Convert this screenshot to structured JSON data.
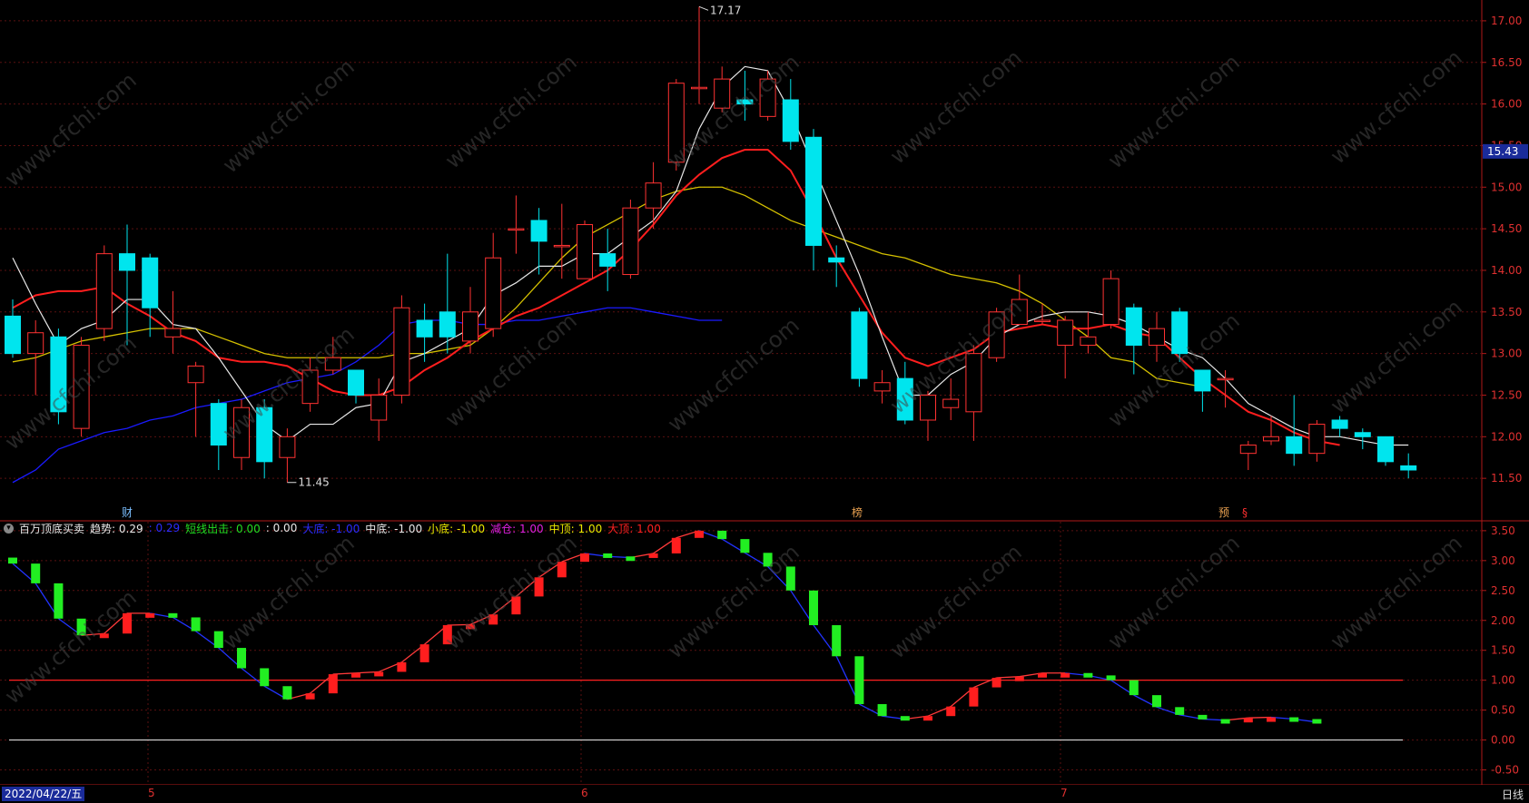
{
  "chart_data": [
    {
      "type": "candlestick",
      "title": "",
      "ylim": [
        11.0,
        17.25
      ],
      "yticks": [
        11.5,
        12.0,
        12.5,
        13.0,
        13.5,
        14.0,
        14.5,
        15.0,
        15.5,
        16.0,
        16.5,
        17.0
      ],
      "current_price": 15.43,
      "annotations": {
        "high": "17.17",
        "low": "11.45"
      },
      "colors": {
        "up": "#ff3232",
        "down": "#00e5ee",
        "ma5": "#e8e8e8",
        "ma10": "#ff1e1e",
        "ma20": "#d4c000",
        "ma60": "#1a1aff"
      },
      "candles": [
        [
          13.45,
          13.0,
          13.65,
          12.95
        ],
        [
          13.0,
          13.25,
          13.4,
          12.5
        ],
        [
          13.2,
          12.3,
          13.3,
          12.15
        ],
        [
          12.1,
          13.1,
          13.2,
          12.0
        ],
        [
          13.3,
          14.2,
          14.3,
          13.15
        ],
        [
          14.2,
          14.0,
          14.55,
          13.1
        ],
        [
          14.15,
          13.55,
          14.2,
          13.2
        ],
        [
          13.2,
          13.3,
          13.75,
          13.0
        ],
        [
          12.65,
          12.85,
          12.9,
          12.0
        ],
        [
          12.4,
          11.9,
          12.45,
          11.6
        ],
        [
          11.75,
          12.35,
          12.45,
          11.6
        ],
        [
          12.35,
          11.7,
          12.45,
          11.5
        ],
        [
          11.75,
          12.0,
          12.1,
          11.45
        ],
        [
          12.4,
          12.8,
          12.95,
          12.3
        ],
        [
          12.8,
          12.95,
          13.2,
          12.75
        ],
        [
          12.8,
          12.5,
          12.8,
          12.4
        ],
        [
          12.2,
          12.5,
          12.7,
          11.95
        ],
        [
          12.5,
          13.55,
          13.7,
          12.4
        ],
        [
          13.4,
          13.2,
          13.6,
          12.9
        ],
        [
          13.5,
          13.2,
          14.2,
          13.0
        ],
        [
          13.15,
          13.5,
          13.8,
          13.0
        ],
        [
          13.3,
          14.15,
          14.45,
          13.2
        ],
        [
          14.5,
          14.5,
          14.9,
          14.2
        ],
        [
          14.6,
          14.35,
          14.75,
          13.95
        ],
        [
          14.3,
          14.3,
          14.8,
          13.9
        ],
        [
          13.9,
          14.55,
          14.6,
          13.9
        ],
        [
          14.2,
          14.05,
          14.5,
          13.75
        ],
        [
          13.95,
          14.75,
          14.85,
          13.9
        ],
        [
          14.75,
          15.05,
          15.3,
          14.5
        ],
        [
          15.3,
          16.25,
          16.3,
          15.2
        ],
        [
          16.2,
          16.2,
          17.17,
          16.0
        ],
        [
          15.95,
          16.3,
          16.45,
          15.9
        ],
        [
          16.05,
          16.0,
          16.4,
          15.8
        ],
        [
          15.85,
          16.3,
          16.4,
          15.8
        ],
        [
          16.05,
          15.55,
          16.3,
          15.45
        ],
        [
          15.6,
          14.3,
          15.7,
          14.0
        ],
        [
          14.15,
          14.1,
          14.3,
          13.8
        ],
        [
          13.5,
          12.7,
          13.55,
          12.6
        ],
        [
          12.55,
          12.65,
          12.8,
          12.4
        ],
        [
          12.7,
          12.2,
          12.9,
          12.15
        ],
        [
          12.2,
          12.5,
          12.55,
          11.95
        ],
        [
          12.35,
          12.45,
          12.7,
          12.2
        ],
        [
          12.3,
          13.0,
          13.1,
          11.95
        ],
        [
          12.95,
          13.5,
          13.55,
          12.9
        ],
        [
          13.35,
          13.65,
          13.95,
          13.35
        ],
        [
          13.4,
          13.4,
          13.6,
          13.35
        ],
        [
          13.1,
          13.4,
          13.45,
          12.7
        ],
        [
          13.1,
          13.2,
          13.5,
          13.0
        ],
        [
          13.35,
          13.9,
          14.0,
          13.3
        ],
        [
          13.55,
          13.1,
          13.6,
          12.75
        ],
        [
          13.1,
          13.3,
          13.5,
          12.9
        ],
        [
          13.5,
          13.0,
          13.55,
          12.9
        ],
        [
          12.8,
          12.55,
          12.8,
          12.3
        ],
        [
          12.7,
          12.7,
          12.8,
          12.35
        ],
        [
          11.8,
          11.9,
          11.95,
          11.6
        ],
        [
          11.95,
          12.0,
          12.25,
          11.9
        ],
        [
          12.0,
          11.8,
          12.5,
          11.65
        ],
        [
          11.8,
          12.15,
          12.2,
          11.7
        ],
        [
          12.2,
          12.1,
          12.25,
          12.0
        ],
        [
          12.05,
          12.0,
          12.1,
          11.85
        ],
        [
          12.0,
          11.7,
          12.0,
          11.65
        ],
        [
          11.65,
          11.6,
          11.8,
          11.5
        ]
      ],
      "ma5": [
        14.15,
        13.6,
        13.1,
        13.3,
        13.4,
        13.65,
        13.65,
        13.35,
        13.3,
        12.95,
        12.55,
        12.15,
        11.95,
        12.15,
        12.15,
        12.35,
        12.4,
        12.9,
        13.0,
        13.15,
        13.3,
        13.7,
        13.85,
        14.05,
        14.05,
        14.2,
        14.2,
        14.4,
        14.6,
        14.95,
        15.7,
        16.2,
        16.45,
        16.4,
        15.9,
        15.25,
        14.6,
        13.95,
        13.2,
        12.5,
        12.5,
        12.75,
        12.9,
        13.2,
        13.35,
        13.45,
        13.5,
        13.5,
        13.45,
        13.35,
        13.2,
        13.05,
        12.95,
        12.7,
        12.4,
        12.25,
        12.1,
        12.0,
        12.0,
        11.95,
        11.9,
        11.9
      ],
      "ma10": [
        13.55,
        13.7,
        13.75,
        13.75,
        13.8,
        13.6,
        13.45,
        13.25,
        13.15,
        12.95,
        12.9,
        12.9,
        12.85,
        12.7,
        12.55,
        12.5,
        12.5,
        12.6,
        12.8,
        12.95,
        13.15,
        13.3,
        13.45,
        13.55,
        13.7,
        13.85,
        14.0,
        14.25,
        14.55,
        14.9,
        15.15,
        15.35,
        15.45,
        15.45,
        15.2,
        14.7,
        14.15,
        13.7,
        13.25,
        12.95,
        12.85,
        12.95,
        13.05,
        13.25,
        13.3,
        13.35,
        13.3,
        13.3,
        13.35,
        13.25,
        13.2,
        12.95,
        12.7,
        12.5,
        12.3,
        12.2,
        12.05,
        11.95,
        11.9
      ],
      "ma20": [
        12.9,
        12.95,
        13.05,
        13.15,
        13.2,
        13.25,
        13.3,
        13.3,
        13.3,
        13.2,
        13.1,
        13.0,
        12.95,
        12.95,
        12.95,
        12.95,
        12.95,
        13.0,
        13.0,
        13.05,
        13.1,
        13.3,
        13.55,
        13.85,
        14.15,
        14.4,
        14.55,
        14.7,
        14.85,
        14.95,
        15.0,
        15.0,
        14.9,
        14.75,
        14.6,
        14.5,
        14.4,
        14.3,
        14.2,
        14.15,
        14.05,
        13.95,
        13.9,
        13.85,
        13.75,
        13.6,
        13.4,
        13.2,
        12.95,
        12.9,
        12.7,
        12.65,
        12.6
      ],
      "ma60": [
        11.45,
        11.6,
        11.85,
        11.95,
        12.05,
        12.1,
        12.2,
        12.25,
        12.35,
        12.4,
        12.45,
        12.55,
        12.65,
        12.7,
        12.75,
        12.9,
        13.1,
        13.35,
        13.4,
        13.4,
        13.35,
        13.35,
        13.4,
        13.4,
        13.45,
        13.5,
        13.55,
        13.55,
        13.5,
        13.45,
        13.4,
        13.4
      ]
    },
    {
      "type": "indicator",
      "title": "百万顶底买卖",
      "ylim": [
        -0.75,
        3.65
      ],
      "yticks": [
        -0.5,
        0.0,
        0.5,
        1.0,
        1.5,
        2.0,
        2.5,
        3.0,
        3.5
      ],
      "hlines": [
        {
          "value": 1.0,
          "color": "#ff2020"
        },
        {
          "value": 0.0,
          "color": "#d8d8d8"
        },
        {
          "value": -1.0,
          "color": "#d4c000"
        }
      ],
      "values": [
        2.95,
        2.62,
        2.03,
        1.75,
        1.78,
        2.12,
        2.12,
        2.05,
        1.82,
        1.54,
        1.2,
        0.9,
        0.68,
        0.78,
        1.1,
        1.12,
        1.14,
        1.3,
        1.6,
        1.92,
        1.93,
        2.1,
        2.4,
        2.72,
        2.98,
        3.12,
        3.07,
        3.05,
        3.12,
        3.38,
        3.5,
        3.36,
        3.13,
        2.9,
        2.5,
        1.92,
        1.4,
        0.6,
        0.4,
        0.35,
        0.4,
        0.56,
        0.88,
        1.04,
        1.06,
        1.12,
        1.12,
        1.08,
        1.0,
        0.75,
        0.55,
        0.42,
        0.35,
        0.33,
        0.37,
        0.38,
        0.35,
        0.3
      ]
    }
  ],
  "legend": {
    "name": "百万顶底买卖",
    "items": [
      {
        "label": "趋势: 0.29",
        "color": "#e8e8e8"
      },
      {
        "label": ": 0.29",
        "color": "#2b2bff"
      },
      {
        "label": "短线出击: 0.00",
        "color": "#22dd22"
      },
      {
        "label": ": 0.00",
        "color": "#e8e8e8"
      },
      {
        "label": "大底: -1.00",
        "color": "#2b2bff"
      },
      {
        "label": "中底: -1.00",
        "color": "#e8e8e8"
      },
      {
        "label": "小底: -1.00",
        "color": "#e8e800"
      },
      {
        "label": "减仓: 1.00",
        "color": "#e020e0"
      },
      {
        "label": "中顶: 1.00",
        "color": "#e8e800"
      },
      {
        "label": "大顶: 1.00",
        "color": "#ff2020"
      }
    ]
  },
  "markers": [
    {
      "text": "财",
      "color": "#7bbfff"
    },
    {
      "text": "榜",
      "color": "#e8a050"
    },
    {
      "text": "预",
      "color": "#e8a050"
    },
    {
      "text": "§",
      "color": "#ff3030"
    }
  ],
  "bottom_bar": {
    "date": "2022/04/22/五",
    "months": [
      "5",
      "6",
      "7"
    ],
    "period": "日线"
  },
  "watermark": "www.cfchi.com"
}
